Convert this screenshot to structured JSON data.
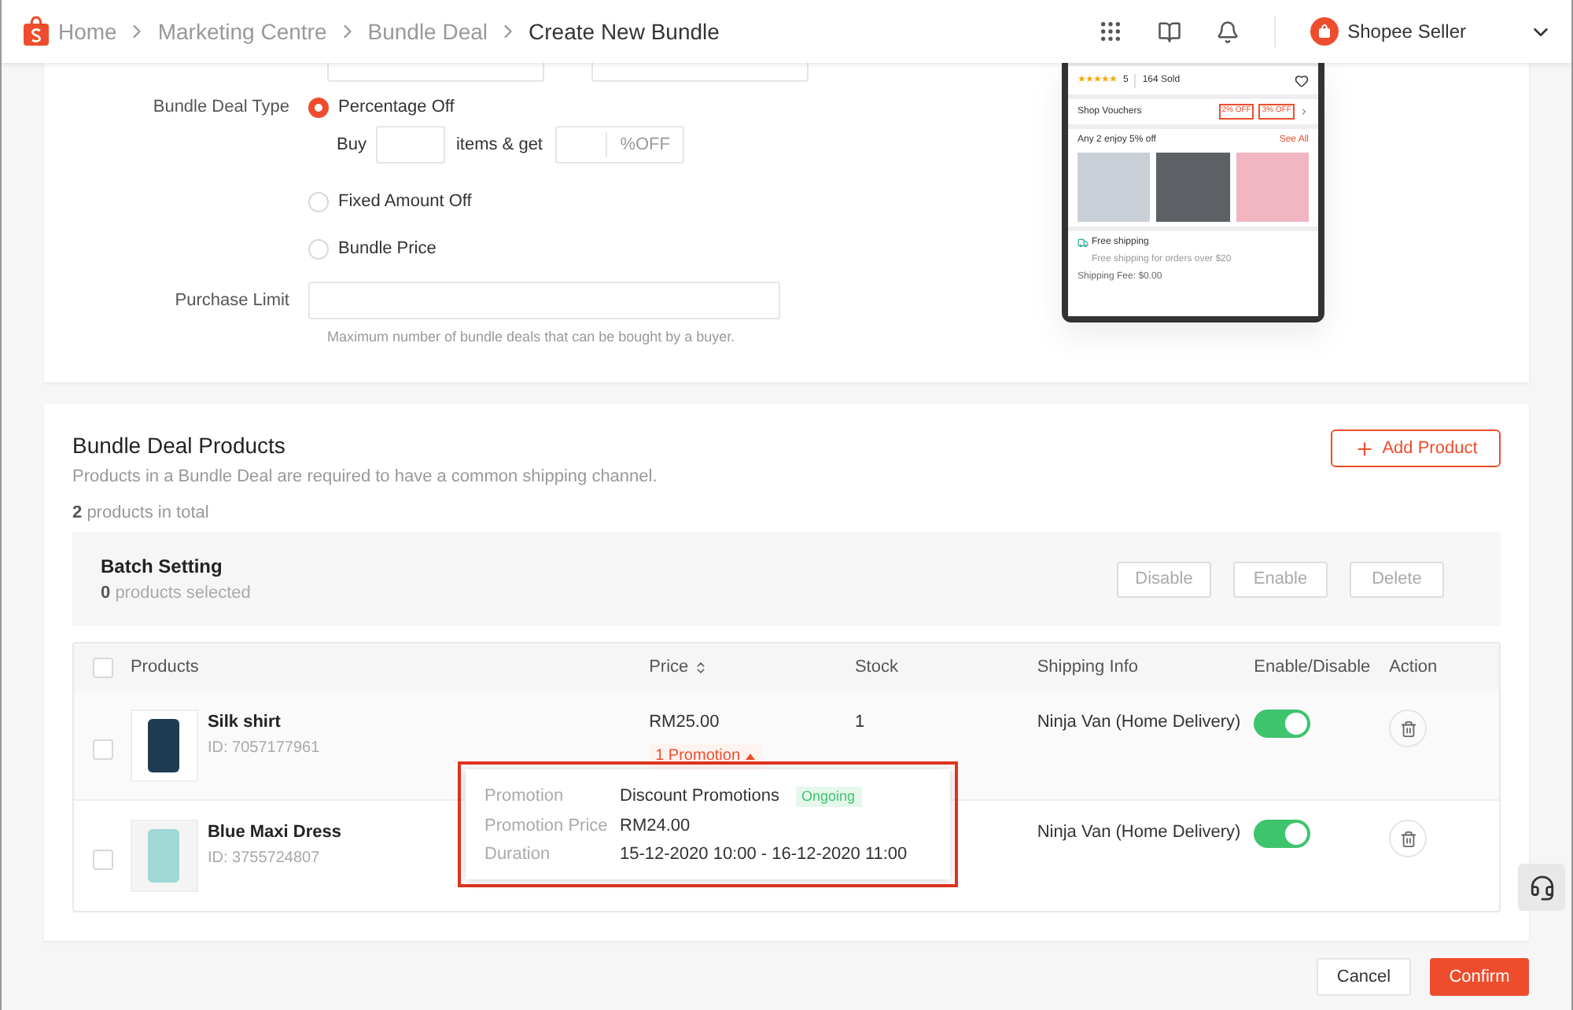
{
  "header": {
    "breadcrumbs": [
      {
        "label": "Home",
        "current": false
      },
      {
        "label": "Marketing Centre",
        "current": false
      },
      {
        "label": "Bundle Deal",
        "current": false
      },
      {
        "label": "Create New Bundle",
        "current": true
      }
    ],
    "seller": "Shopee Seller"
  },
  "form": {
    "type_label": "Bundle Deal Type",
    "options": [
      {
        "kind": "percentage",
        "label": "Percentage Off",
        "selected": true,
        "buy": "Buy",
        "items_get": "items & get",
        "suffix": "%OFF"
      },
      {
        "kind": "plain",
        "label": "Fixed Amount Off",
        "selected": false
      },
      {
        "kind": "plain",
        "label": "Bundle Price",
        "selected": false
      }
    ],
    "limit_label": "Purchase Limit",
    "limit_hint": "Maximum number of bundle deals that can be bought by a buyer."
  },
  "phone": {
    "stars": 5,
    "rating": "5",
    "sold": "164 Sold",
    "vouchers": "Shop Vouchers",
    "voucher_tags": [
      "2% OFF",
      "3% OFF"
    ],
    "bundle_title": "Any 2 enjoy 5% off",
    "see_all": "See All",
    "free_shipping": "Free shipping",
    "free_shipping_note": "Free shipping for orders over $20",
    "shipping_fee": "Shipping Fee: $0.00"
  },
  "products": {
    "title": "Bundle Deal Products",
    "subtitle": "Products in a Bundle Deal are required to have a common shipping channel.",
    "total_count": "2",
    "total_text": "products in total",
    "add_button": "Add Product",
    "batch": {
      "title": "Batch Setting",
      "count": "0",
      "count_text": "products selected",
      "buttons": [
        "Disable",
        "Enable",
        "Delete"
      ]
    },
    "all_checked": false,
    "columns": [
      {
        "label": "Products",
        "sortable": false
      },
      {
        "label": "Price",
        "sortable": true
      },
      {
        "label": "Stock",
        "sortable": false
      },
      {
        "label": "Shipping Info",
        "sortable": false
      },
      {
        "label": "Enable/Disable",
        "sortable": false
      },
      {
        "label": "Action",
        "sortable": false
      }
    ],
    "rows": [
      {
        "name": "Silk shirt",
        "id": "ID: 7057177961",
        "price": "RM25.00",
        "promotion": "1 Promotion",
        "stock": "1",
        "shipping": "Ninja Van (Home Delivery)",
        "enabled": true,
        "checked": false
      },
      {
        "name": "Blue Maxi Dress",
        "id": "ID: 3755724807",
        "shipping": "Ninja Van (Home Delivery)",
        "enabled": true,
        "checked": false
      }
    ],
    "popover": {
      "rows": [
        {
          "label": "Promotion",
          "value": "Discount Promotions",
          "badge": "Ongoing"
        },
        {
          "label": "Promotion Price",
          "value": "RM24.00"
        },
        {
          "label": "Duration",
          "value": "15-12-2020 10:00 - 16-12-2020 11:00"
        }
      ]
    }
  },
  "footer": {
    "cancel": "Cancel",
    "confirm": "Confirm"
  }
}
